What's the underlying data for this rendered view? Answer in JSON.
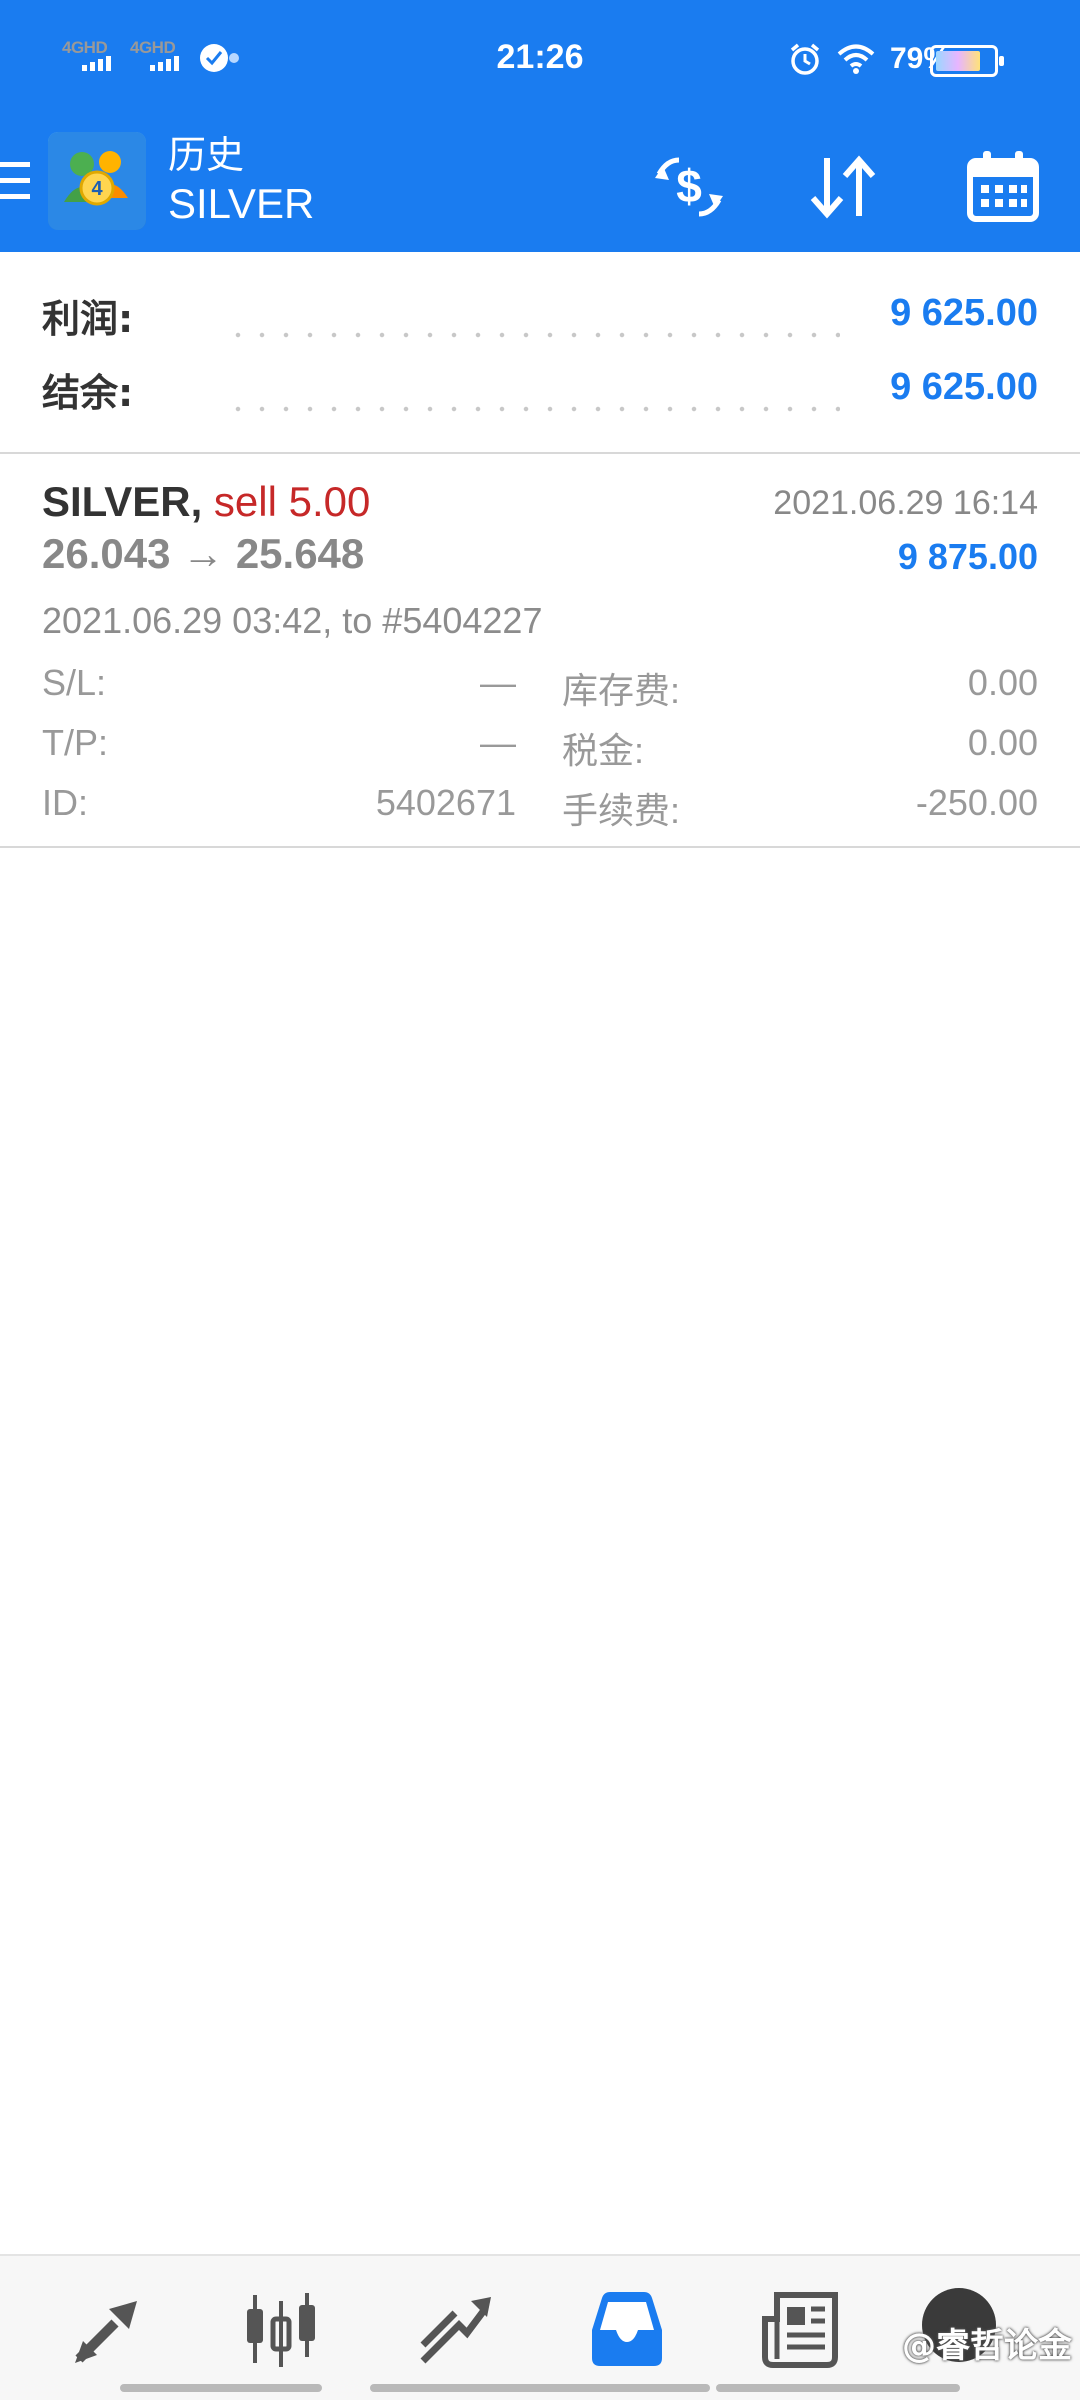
{
  "status_bar": {
    "network_1": "4GHD",
    "network_2": "4GHD",
    "time": "21:26",
    "battery_text": "79%",
    "battery_level": 0.79
  },
  "app_bar": {
    "title": "历史",
    "subtitle": "SILVER",
    "icons": [
      "menu-icon",
      "metatrader-logo",
      "currency-exchange-icon",
      "sort-icon",
      "calendar-icon"
    ]
  },
  "summary": {
    "profit_label": "利润:",
    "profit_value": "9 625.00",
    "balance_label": "结余:",
    "balance_value": "9 625.00"
  },
  "deal": {
    "symbol": "SILVER,",
    "side_volume": "sell 5.00",
    "close_time": "2021.06.29 16:14",
    "price_open": "26.043",
    "arrow": "→",
    "price_close": "25.648",
    "profit": "9 875.00",
    "open_info": "2021.06.29 03:42, to #5404227",
    "sl_label": "S/L:",
    "sl_value": "—",
    "tp_label": "T/P:",
    "tp_value": "—",
    "id_label": "ID:",
    "id_value": "5402671",
    "swap_label": "库存费:",
    "swap_value": "0.00",
    "tax_label": "税金:",
    "tax_value": "0.00",
    "commission_label": "手续费:",
    "commission_value": "-250.00"
  },
  "bottom_nav": {
    "items": [
      "quotes-icon",
      "chart-icon",
      "trade-icon",
      "history-icon",
      "news-icon",
      "messages-icon"
    ],
    "active": "history-icon",
    "watermark": "@睿哲论金"
  },
  "colors": {
    "primary": "#1a7cf0",
    "sell": "#c62828",
    "text_dark": "#333333",
    "text_muted": "#999999"
  }
}
